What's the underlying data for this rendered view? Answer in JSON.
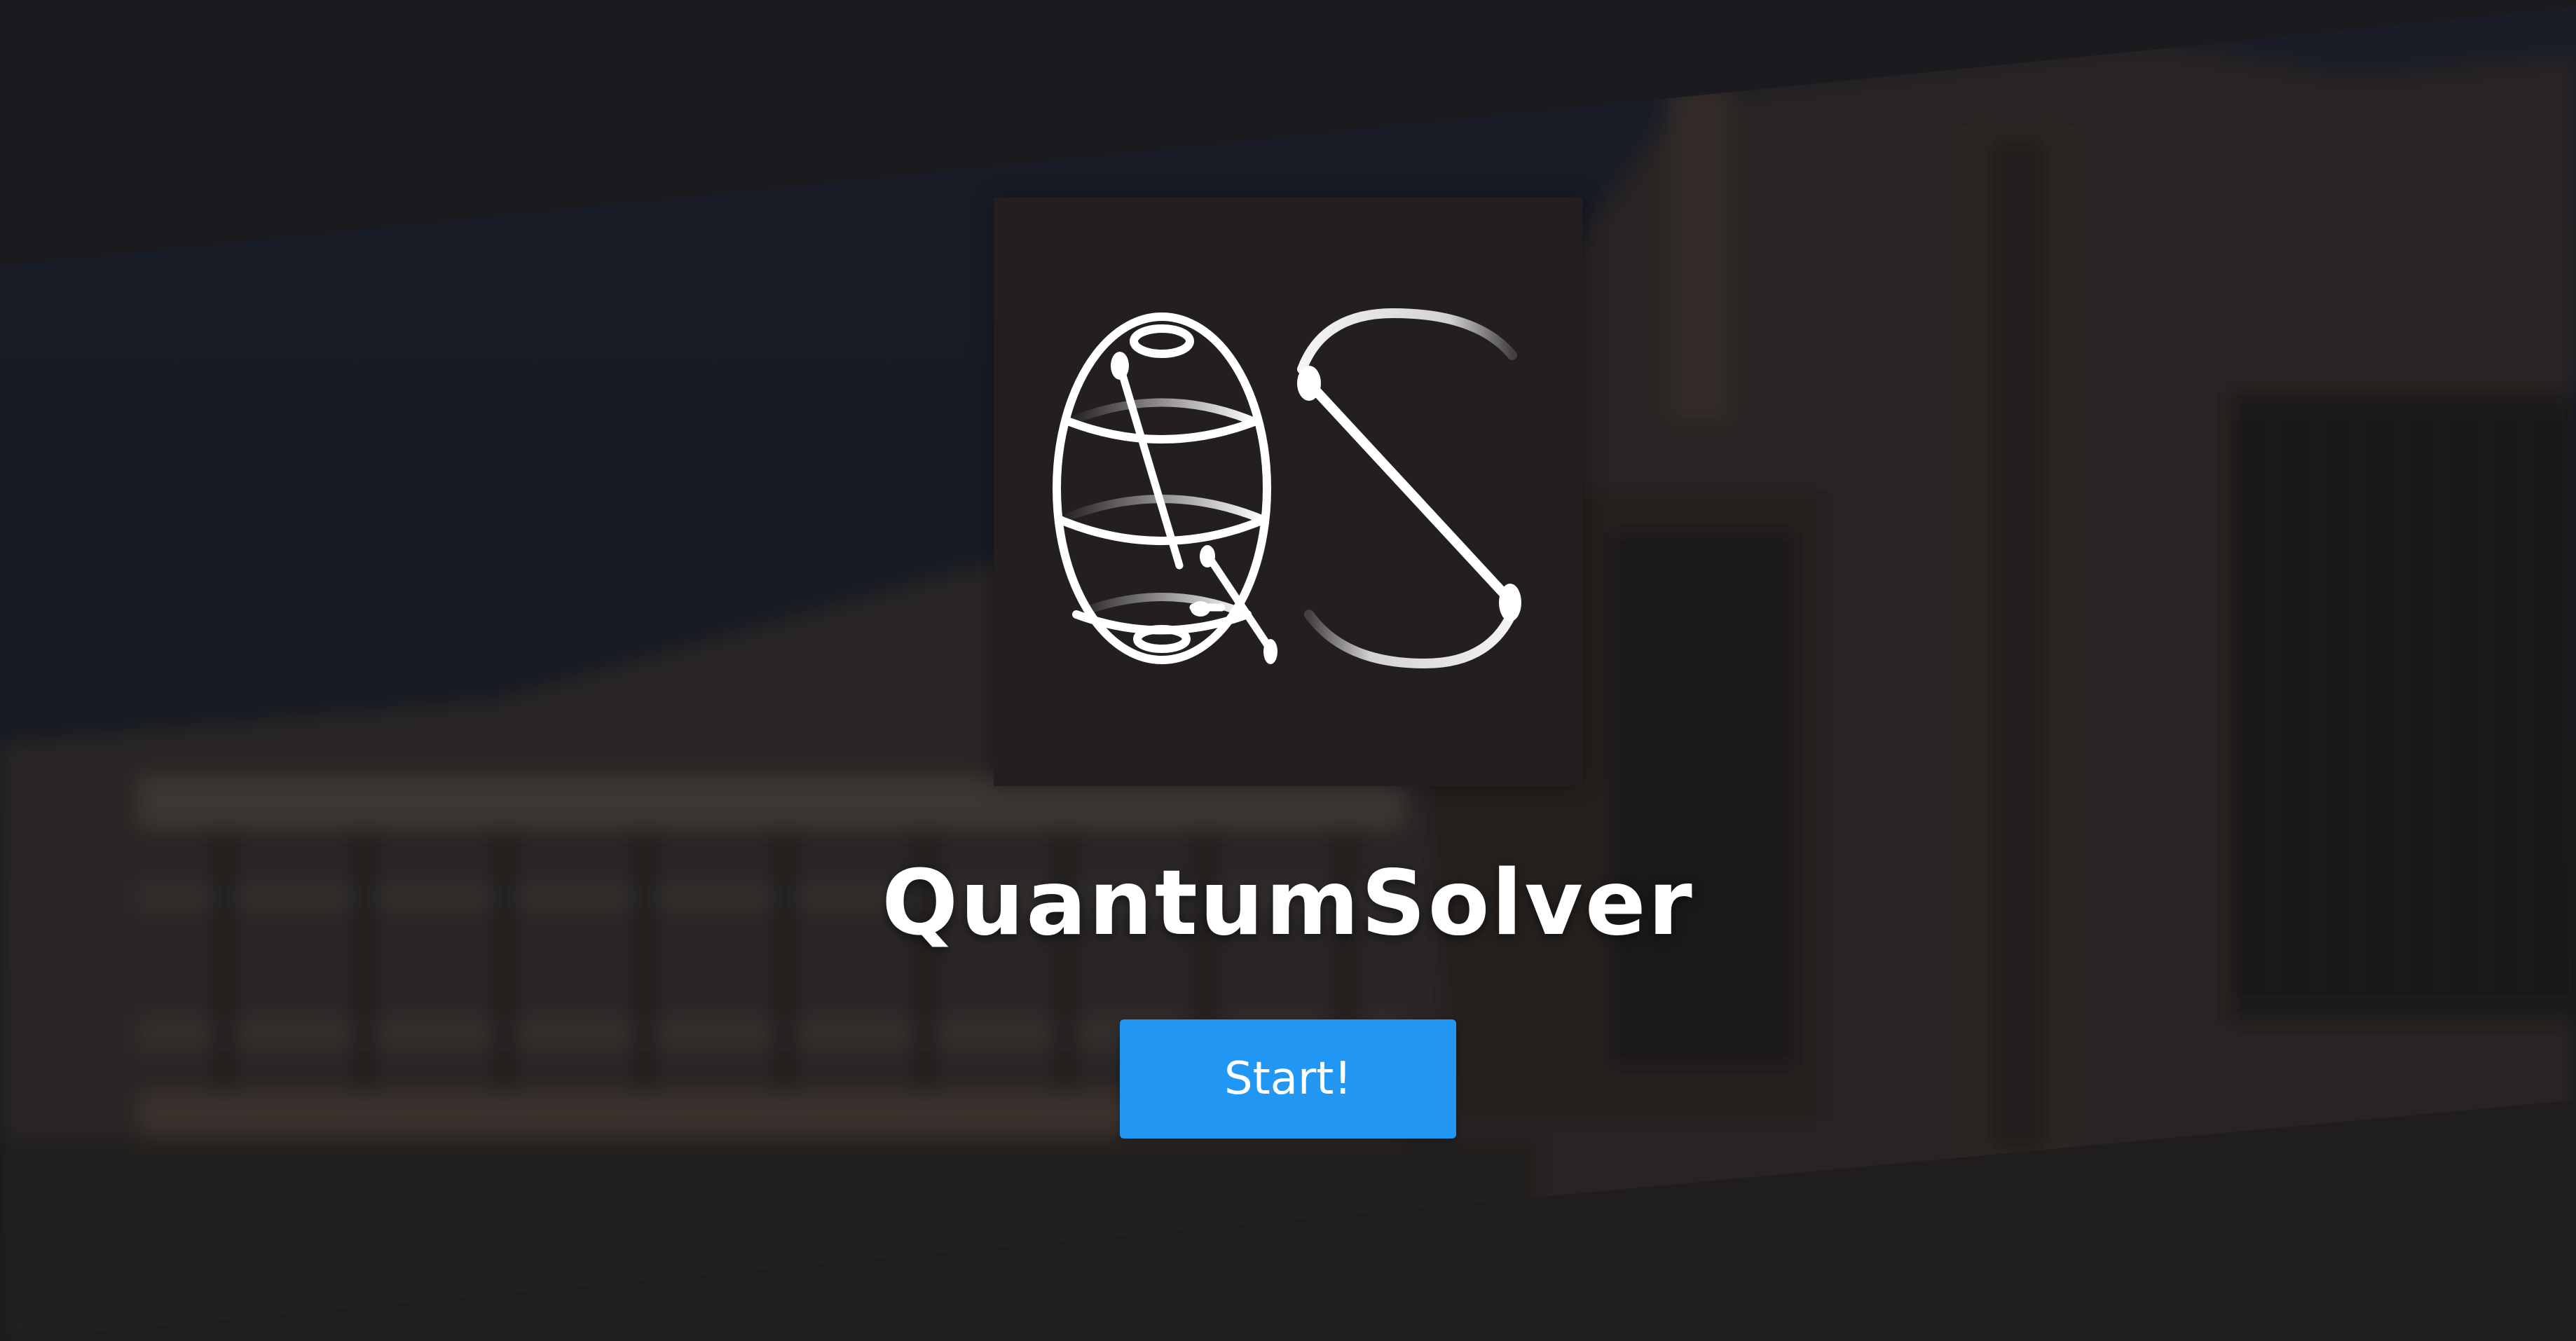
{
  "app": {
    "title": "QuantumSolver",
    "start_label": "Start!"
  },
  "logo": {
    "monogram_letters": "QS"
  },
  "colors": {
    "accent": "#2196f3",
    "logo_background": "#231f20",
    "text": "#ffffff"
  }
}
